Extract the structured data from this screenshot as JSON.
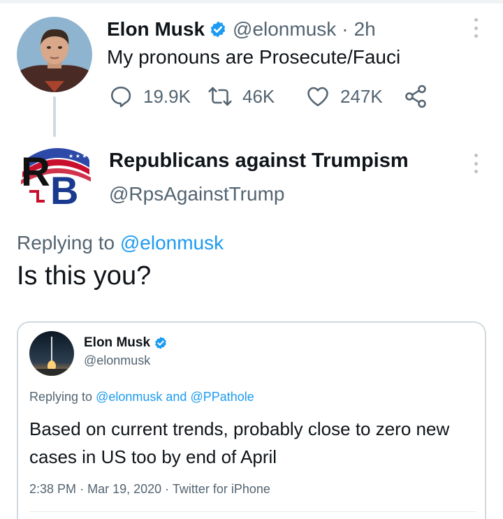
{
  "parent_tweet": {
    "author_name": "Elon Musk",
    "author_handle": "@elonmusk",
    "separator": "·",
    "age": "2h",
    "text": "My pronouns are Prosecute/Fauci",
    "replies": "19.9K",
    "retweets": "46K",
    "likes": "247K"
  },
  "main_tweet": {
    "author_name": "Republicans against Trumpism",
    "author_handle": "@RpsAgainstTrump",
    "replying_prefix": "Replying to",
    "replying_to": "@elonmusk",
    "text": "Is this you?",
    "avatar_letters": "RB"
  },
  "quoted_screenshot": {
    "author_name": "Elon Musk",
    "author_handle": "@elonmusk",
    "replying_prefix": "Replying to",
    "replying_to_1": "@elonmusk",
    "replying_conjunction": "and",
    "replying_to_2": "@PPathole",
    "text": "Based on current trends, probably close to zero new cases in US too by end of April",
    "time": "2:38 PM",
    "date": "Mar 19, 2020",
    "source": "Twitter for iPhone",
    "separator": "·"
  },
  "colors": {
    "accent": "#1d9bf0",
    "secondary_text": "#536471",
    "primary_text": "#0f1419",
    "rb_red": "#c8102e",
    "rb_blue": "#1a3a8f"
  },
  "icons": [
    "more-icon",
    "verified-icon",
    "reply-icon",
    "retweet-icon",
    "like-icon",
    "share-icon"
  ]
}
